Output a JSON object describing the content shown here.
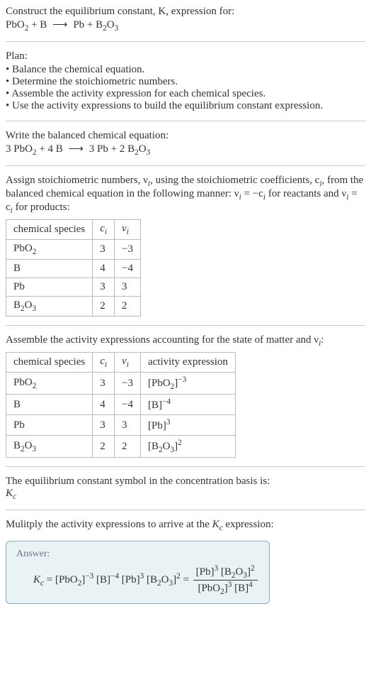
{
  "header": {
    "prompt": "Construct the equilibrium constant, K, expression for:",
    "equation_left_1": "PbO",
    "equation_left_1_sub": "2",
    "plus1": " + ",
    "equation_left_2": "B",
    "arrow": "⟶",
    "equation_right_1": "Pb + B",
    "equation_right_1_sub": "2",
    "equation_right_2": "O",
    "equation_right_2_sub": "3"
  },
  "plan": {
    "title": "Plan:",
    "items": [
      "Balance the chemical equation.",
      "Determine the stoichiometric numbers.",
      "Assemble the activity expression for each chemical species.",
      "Use the activity expressions to build the equilibrium constant expression."
    ]
  },
  "balanced": {
    "title": "Write the balanced chemical equation:",
    "c1": "3 PbO",
    "c1_sub": "2",
    "plus1": " + 4 B ",
    "arrow": "⟶",
    "c2": " 3 Pb + 2 B",
    "c2_sub": "2",
    "c3": "O",
    "c3_sub": "3"
  },
  "assign_intro_1": "Assign stoichiometric numbers, ν",
  "assign_intro_1_sub": "i",
  "assign_intro_2": ", using the stoichiometric coefficients, c",
  "assign_intro_2_sub": "i",
  "assign_intro_3": ", from the balanced chemical equation in the following manner: ν",
  "assign_intro_3_sub": "i",
  "assign_intro_4": " = −c",
  "assign_intro_4_sub": "i",
  "assign_intro_5": " for reactants and ν",
  "assign_intro_5_sub": "i",
  "assign_intro_6": " = c",
  "assign_intro_6_sub": "i",
  "assign_intro_7": " for products:",
  "table1": {
    "h1": "chemical species",
    "h2": "c",
    "h2_sub": "i",
    "h3": "ν",
    "h3_sub": "i",
    "rows": [
      {
        "sp": "PbO",
        "sp_sub": "2",
        "c": "3",
        "v": "−3"
      },
      {
        "sp": "B",
        "sp_sub": "",
        "c": "4",
        "v": "−4"
      },
      {
        "sp": "Pb",
        "sp_sub": "",
        "c": "3",
        "v": "3"
      },
      {
        "sp": "B",
        "sp_sub": "2",
        "sp2": "O",
        "sp2_sub": "3",
        "c": "2",
        "v": "2"
      }
    ]
  },
  "activity_intro_1": "Assemble the activity expressions accounting for the state of matter and ν",
  "activity_intro_1_sub": "i",
  "activity_intro_2": ":",
  "table2": {
    "h1": "chemical species",
    "h2": "c",
    "h2_sub": "i",
    "h3": "ν",
    "h3_sub": "i",
    "h4": "activity expression",
    "rows": [
      {
        "sp": "PbO",
        "sp_sub": "2",
        "c": "3",
        "v": "−3",
        "ae_base": "[PbO",
        "ae_sub": "2",
        "ae_close": "]",
        "ae_pow": "−3"
      },
      {
        "sp": "B",
        "sp_sub": "",
        "c": "4",
        "v": "−4",
        "ae_base": "[B]",
        "ae_sub": "",
        "ae_close": "",
        "ae_pow": "−4"
      },
      {
        "sp": "Pb",
        "sp_sub": "",
        "c": "3",
        "v": "3",
        "ae_base": "[Pb]",
        "ae_sub": "",
        "ae_close": "",
        "ae_pow": "3"
      },
      {
        "sp": "B",
        "sp_sub": "2",
        "sp2": "O",
        "sp2_sub": "3",
        "c": "2",
        "v": "2",
        "ae_base": "[B",
        "ae_sub": "2",
        "ae_mid": "O",
        "ae_sub2": "3",
        "ae_close": "]",
        "ae_pow": "2"
      }
    ]
  },
  "kc_intro_1": "The equilibrium constant symbol in the concentration basis is:",
  "kc_symbol_main": "K",
  "kc_symbol_sub": "c",
  "mult_intro_1": "Mulitply the activity expressions to arrive at the ",
  "mult_intro_kc": "K",
  "mult_intro_kc_sub": "c",
  "mult_intro_2": " expression:",
  "answer": {
    "label": "Answer:",
    "lhs_K": "K",
    "lhs_K_sub": "c",
    "eq": " = ",
    "t1": "[PbO",
    "t1_sub": "2",
    "t1_close": "]",
    "t1_pow": "−3",
    "t2": " [B]",
    "t2_pow": "−4",
    "t3": " [Pb]",
    "t3_pow": "3",
    "t4": " [B",
    "t4_sub": "2",
    "t4_mid": "O",
    "t4_sub2": "3",
    "t4_close": "]",
    "t4_pow": "2",
    "eq2": " = ",
    "num1": "[Pb]",
    "num1_pow": "3",
    "num2": " [B",
    "num2_sub": "2",
    "num2_mid": "O",
    "num2_sub2": "3",
    "num2_close": "]",
    "num2_pow": "2",
    "den1": "[PbO",
    "den1_sub": "2",
    "den1_close": "]",
    "den1_pow": "3",
    "den2": " [B]",
    "den2_pow": "4"
  }
}
